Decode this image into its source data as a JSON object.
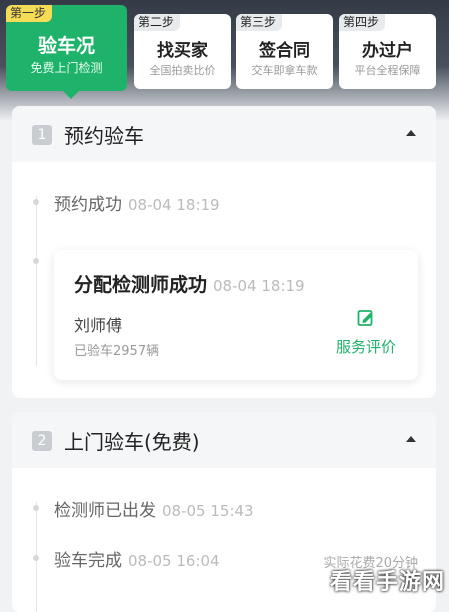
{
  "steps": [
    {
      "tag": "第一步",
      "title": "验车况",
      "sub": "免费上门检测",
      "active": true
    },
    {
      "tag": "第二步",
      "title": "找买家",
      "sub": "全国拍卖比价",
      "active": false
    },
    {
      "tag": "第三步",
      "title": "签合同",
      "sub": "交车即拿车款",
      "active": false
    },
    {
      "tag": "第四步",
      "title": "办过户",
      "sub": "平台全程保障",
      "active": false
    }
  ],
  "section1": {
    "number": "1",
    "title": "预约验车",
    "events": [
      {
        "title": "预约成功",
        "time": "08-04 18:19"
      }
    ],
    "inspection_card": {
      "title": "分配检测师成功",
      "time": "08-04 18:19",
      "inspector": "刘师傅",
      "inspected_count": "已验车2957辆",
      "rate_label": "服务评价"
    }
  },
  "section2": {
    "number": "2",
    "title": "上门验车(免费)",
    "events": [
      {
        "title": "检测师已出发",
        "time": "08-05 15:43"
      },
      {
        "title": "验车完成",
        "time": "08-05 16:04"
      }
    ],
    "fee_note": "实际花费20分钟"
  },
  "watermark": "看看手游网",
  "colors": {
    "accent": "#1fb26a",
    "badge_yellow": "#f5dc57"
  }
}
